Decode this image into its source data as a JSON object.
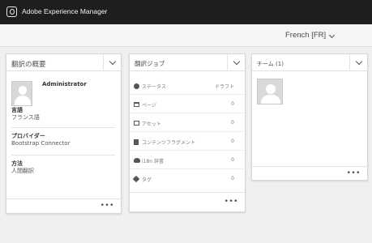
{
  "header": {
    "app_title": "Adobe Experience Manager",
    "logo_icon": "adobe-experience-manager-logo"
  },
  "toolbar": {
    "language_selected": "French [FR]"
  },
  "summary_card": {
    "title": "翻訳の概要",
    "user_name": "Administrator",
    "language_label": "言語",
    "language_value": "フランス語",
    "provider_label": "プロバイダー",
    "provider_value": "Bootstrap Connector",
    "method_label": "方法",
    "method_value": "人間翻訳",
    "more": "•••"
  },
  "jobs_card": {
    "title": "翻訳ジョブ",
    "rows": [
      {
        "icon": "info-icon",
        "label": "ステータス",
        "value": "ドラフト"
      },
      {
        "icon": "page-icon",
        "label": "ページ",
        "value": "0"
      },
      {
        "icon": "asset-icon",
        "label": "アセット",
        "value": "0"
      },
      {
        "icon": "document-icon",
        "label": "コンテンツフラグメント",
        "value": "0"
      },
      {
        "icon": "dictionary-icon",
        "label": "i18n 辞書",
        "value": "0"
      },
      {
        "icon": "tag-icon",
        "label": "タグ",
        "value": "0"
      }
    ],
    "more": "•••"
  },
  "team_card": {
    "title": "チーム (1)",
    "more": "•••"
  }
}
